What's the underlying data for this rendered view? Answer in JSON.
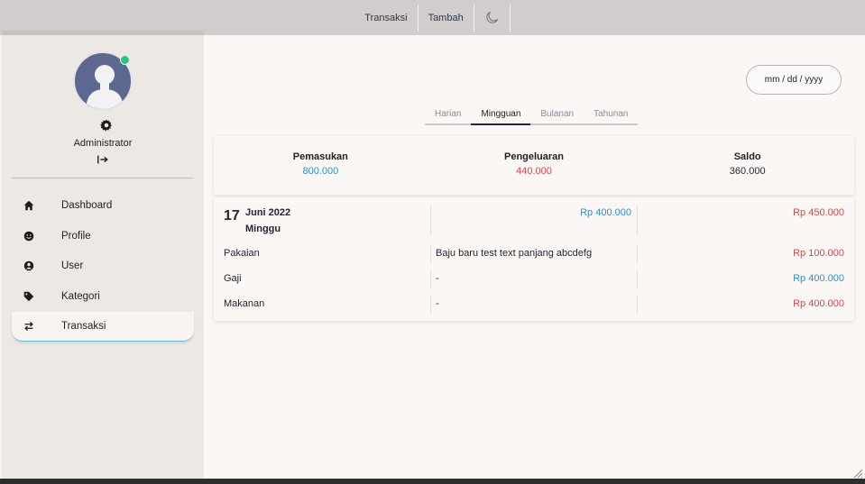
{
  "topnav": {
    "items": [
      {
        "label": "Transaksi"
      },
      {
        "label": "Tambah"
      }
    ],
    "theme_icon": "moon-icon"
  },
  "sidebar": {
    "user_name": "Administrator",
    "status_color": "#2ec27e",
    "items": [
      {
        "label": "Dashboard",
        "icon": "home-icon"
      },
      {
        "label": "Profile",
        "icon": "smile-icon"
      },
      {
        "label": "User",
        "icon": "user-circle-icon"
      },
      {
        "label": "Kategori",
        "icon": "tag-icon"
      },
      {
        "label": "Transaksi",
        "icon": "swap-icon",
        "active": true
      }
    ]
  },
  "filter": {
    "date_placeholder": "mm / dd / yyyy",
    "tabs": [
      {
        "label": "Harian"
      },
      {
        "label": "Mingguan",
        "active": true
      },
      {
        "label": "Bulanan"
      },
      {
        "label": "Tahunan"
      }
    ]
  },
  "summary": {
    "income": {
      "label": "Pemasukan",
      "value": "800.000",
      "color": "#2e8fcf"
    },
    "expense": {
      "label": "Pengeluaran",
      "value": "440.000",
      "color": "#d4484b"
    },
    "balance": {
      "label": "Saldo",
      "value": "360.000",
      "color": "#2a2233"
    }
  },
  "day_group": {
    "day": "17",
    "month_year": "Juni 2022",
    "weekday": "Minggu",
    "total_in": "Rp 400.000",
    "total_out": "Rp 450.000",
    "transactions": [
      {
        "category": "Pakaian",
        "description": "Baju baru test text panjang abcdefg",
        "amount": "Rp 100.000",
        "type": "out"
      },
      {
        "category": "Gaji",
        "description": "-",
        "amount": "Rp 400.000",
        "type": "in"
      },
      {
        "category": "Makanan",
        "description": "-",
        "amount": "Rp 400.000",
        "type": "out"
      }
    ]
  },
  "colors": {
    "income": "#2e8fcf",
    "expense": "#d4484b",
    "accent": "#62b7dd",
    "divider": "#e9a6b3"
  }
}
